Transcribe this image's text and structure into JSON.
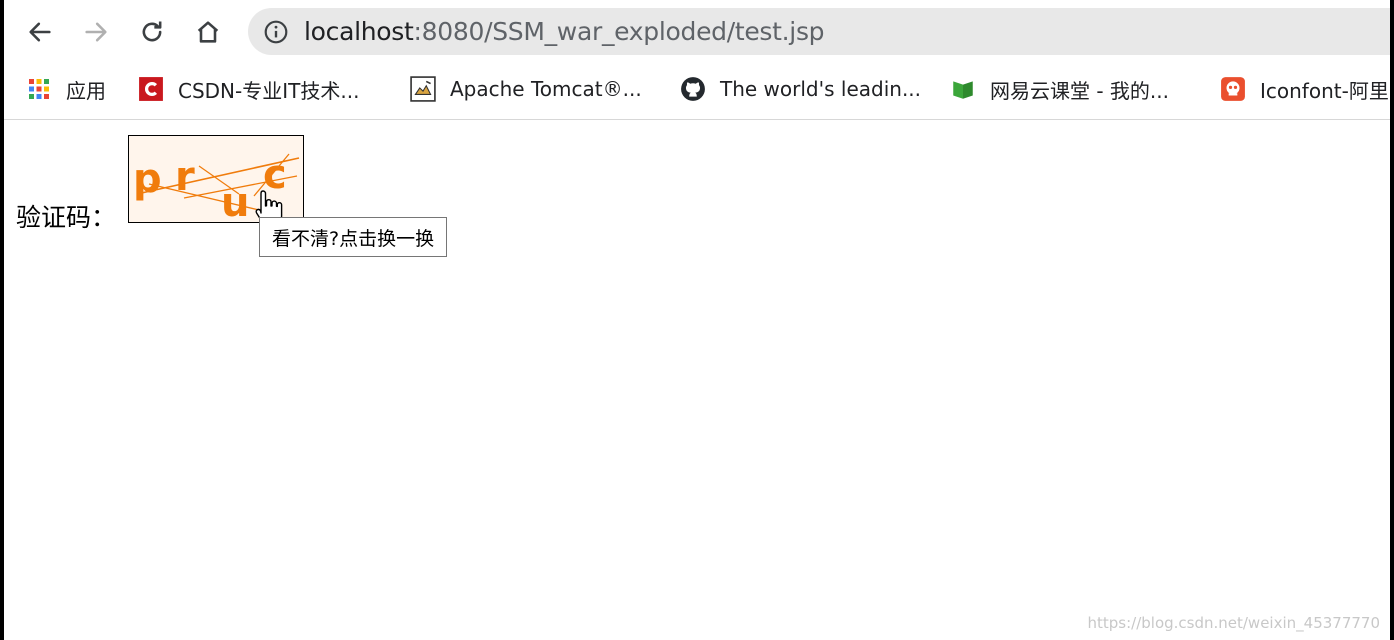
{
  "nav": {
    "back_icon": "arrow-left-icon",
    "forward_icon": "arrow-right-icon",
    "reload_icon": "reload-icon",
    "home_icon": "home-icon"
  },
  "omnibox": {
    "host": "localhost",
    "path": ":8080/SSM_war_exploded/test.jsp",
    "info_icon": "info-icon"
  },
  "bookmarks": [
    {
      "label": "应用",
      "icon": "apps-grid-icon"
    },
    {
      "label": "CSDN-专业IT技术...",
      "icon": "csdn-icon",
      "color": "#c9181e"
    },
    {
      "label": "Apache Tomcat®...",
      "icon": "tomcat-icon"
    },
    {
      "label": "The world's leadin...",
      "icon": "github-icon"
    },
    {
      "label": "网易云课堂 - 我的...",
      "icon": "netease-study-icon",
      "color": "#3ba63a"
    },
    {
      "label": "Iconfont-阿里",
      "icon": "iconfont-icon",
      "color": "#ea4f2e"
    }
  ],
  "page": {
    "captcha_label": "验证码：",
    "captcha_text": "pruc",
    "captcha_color": "#f07c0c",
    "tooltip": "看不清?点击换一换"
  },
  "watermark": "https://blog.csdn.net/weixin_45377770"
}
